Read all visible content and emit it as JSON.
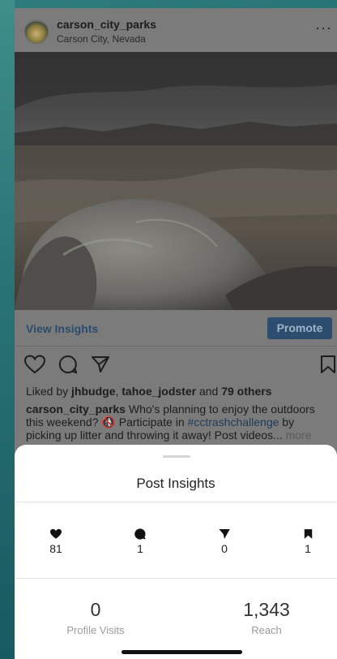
{
  "post": {
    "username": "carson_city_parks",
    "location": "Carson City, Nevada",
    "more_icon": "ellipsis-icon",
    "view_insights_label": "View Insights",
    "promote_label": "Promote",
    "liked_by_prefix": "Liked by ",
    "liked_user_1": "jhbudge",
    "liked_sep": ", ",
    "liked_user_2": "tahoe_jodster",
    "liked_and": " and ",
    "liked_others": "79 others",
    "caption_user": "carson_city_parks",
    "caption_text_1": " Who's planning to enjoy the outdoors this weekend? ",
    "caption_emoji": "🚯",
    "caption_text_2": " Participate in ",
    "caption_hashtag": "#cctrashchallenge",
    "caption_text_3": " by picking up litter and throwing it away! Post videos... ",
    "caption_more": "more"
  },
  "insights_sheet": {
    "title": "Post Insights",
    "metrics": [
      {
        "icon": "heart-icon",
        "value": "81"
      },
      {
        "icon": "comment-icon",
        "value": "1"
      },
      {
        "icon": "send-icon",
        "value": "0"
      },
      {
        "icon": "bookmark-icon",
        "value": "1"
      }
    ],
    "profile_visits": {
      "value": "0",
      "label": "Profile Visits"
    },
    "reach": {
      "value": "1,343",
      "label": "Reach"
    }
  },
  "colors": {
    "accent_blue": "#2c4d6e",
    "sheet_bg": "#ffffff"
  }
}
